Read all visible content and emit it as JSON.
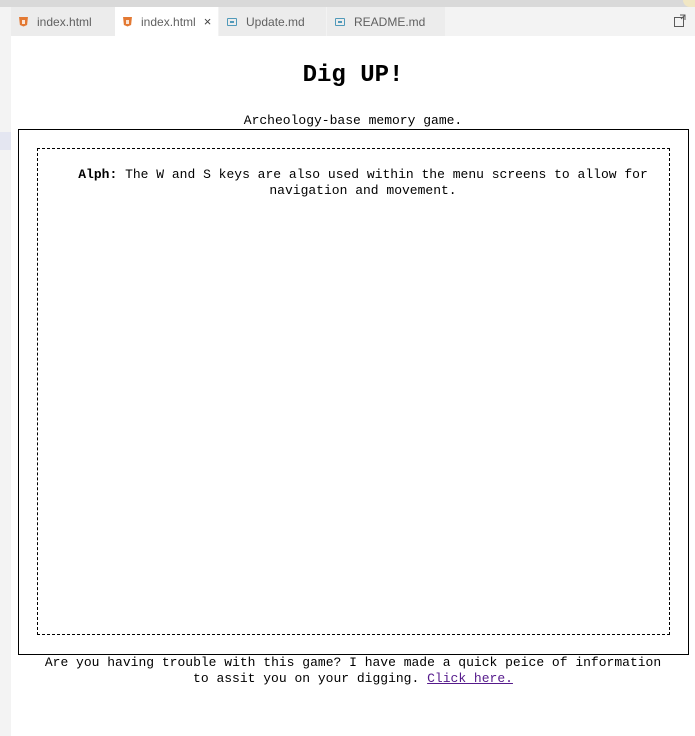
{
  "editor": {
    "tabs": [
      {
        "label": "index.html",
        "icon": "html-file-icon",
        "active": false
      },
      {
        "label": "index.html",
        "icon": "html-file-icon",
        "active": true,
        "close": "×"
      },
      {
        "label": "Update.md",
        "icon": "markdown-file-icon",
        "active": false
      },
      {
        "label": "README.md",
        "icon": "markdown-file-icon",
        "active": false
      }
    ],
    "action_icon": "split-editor-icon"
  },
  "page": {
    "title": "Dig UP!",
    "subtitle": "Archeology-base memory game.",
    "dialog": {
      "speaker": "Alph:",
      "text": "The W and S keys are also used within the menu screens to allow for navigation and movement."
    },
    "help": {
      "text": "Are you having trouble with this game? I have made a quick peice of information to assit you on your digging.",
      "link_label": "Click here."
    }
  },
  "colors": {
    "link": "#551a8b",
    "tab_inactive_bg": "#ececec",
    "tab_active_bg": "#ffffff",
    "html_icon": "#e37933",
    "md_icon": "#519aba"
  }
}
